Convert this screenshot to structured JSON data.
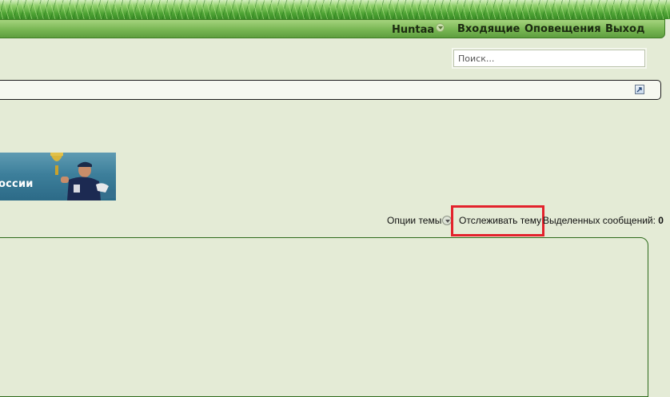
{
  "navbar": {
    "username": "Huntaa",
    "inbox": "Входящие",
    "notifications": "Оповещения",
    "logout": "Выход"
  },
  "search": {
    "placeholder": "Поиск..."
  },
  "banner": {
    "text": "оссии"
  },
  "thread_tools": {
    "options": "Опции темы",
    "subscribe": "Отслеживать тему",
    "selected_label": "Выделенных сообщений:",
    "selected_count": "0"
  },
  "colors": {
    "background": "#e4ebd6",
    "nav_green": "#78b653",
    "highlight": "#e3222c"
  }
}
